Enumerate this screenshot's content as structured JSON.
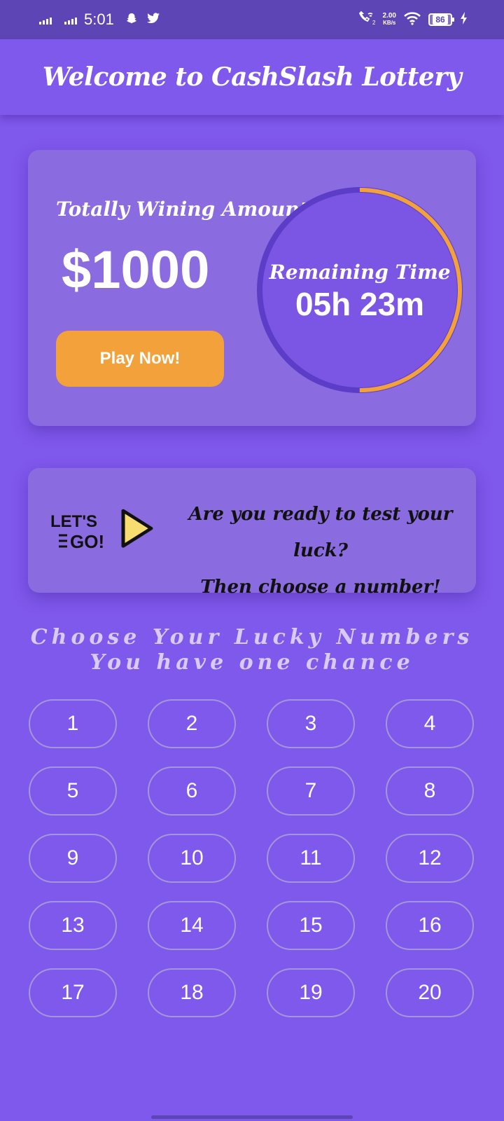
{
  "status_bar": {
    "time": "5:01",
    "network_speed_value": "2.00",
    "network_speed_unit": "KB/s",
    "battery_level": "86",
    "icons": [
      "signal-icon",
      "signal-icon",
      "snapchat-icon",
      "twitter-icon",
      "wifi-call-icon",
      "wifi-icon",
      "battery-icon",
      "charging-icon"
    ]
  },
  "app_bar": {
    "title": "Welcome to CashSlash Lottery"
  },
  "prize_card": {
    "label": "Totally Wining Amount",
    "amount": "$1000",
    "play_button": "Play Now!",
    "timer_label": "Remaining Time",
    "timer_value": "05h 23m",
    "timer_progress": 0.5
  },
  "luck_card": {
    "logo_text_top": "LET'S",
    "logo_text_bottom": "GO!",
    "line1": "Are you ready to test your luck?",
    "line2": "Then choose a number!"
  },
  "lucky_numbers": {
    "heading_line1": "Choose Your Lucky Numbers",
    "heading_line2": "You have one chance",
    "numbers": [
      "1",
      "2",
      "3",
      "4",
      "5",
      "6",
      "7",
      "8",
      "9",
      "10",
      "11",
      "12",
      "13",
      "14",
      "15",
      "16",
      "17",
      "18",
      "19",
      "20"
    ]
  },
  "colors": {
    "background": "#7F58EC",
    "status_bar": "#5E45B5",
    "card": "#8A6BE0",
    "accent": "#F3A13B",
    "timer_track": "#5B3DC8"
  }
}
